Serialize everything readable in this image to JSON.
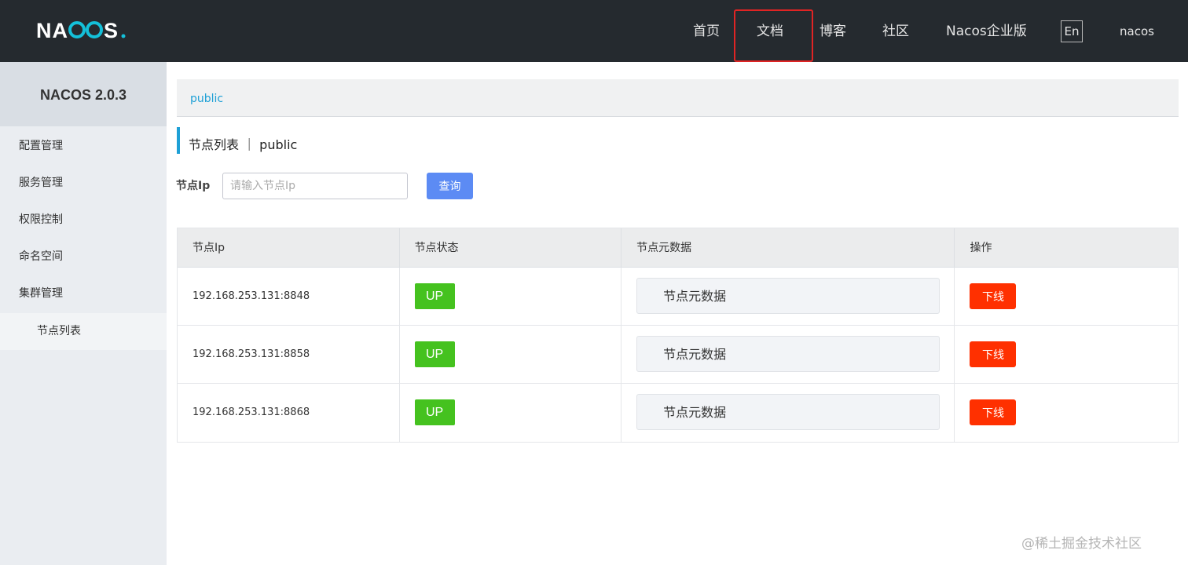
{
  "header": {
    "logo_text": "NACOS.",
    "nav": [
      "首页",
      "文档",
      "博客",
      "社区",
      "Nacos企业版"
    ],
    "lang_label": "En",
    "user": "nacos"
  },
  "sidebar": {
    "title": "NACOS 2.0.3",
    "items": [
      {
        "label": "配置管理"
      },
      {
        "label": "服务管理"
      },
      {
        "label": "权限控制"
      },
      {
        "label": "命名空间"
      },
      {
        "label": "集群管理"
      },
      {
        "label": "节点列表"
      }
    ]
  },
  "breadcrumb": {
    "namespace": "public"
  },
  "page": {
    "title": "节点列表 ｜ public"
  },
  "filter": {
    "label": "节点Ip",
    "placeholder": "请输入节点Ip",
    "value": "",
    "query_label": "查询"
  },
  "table": {
    "headers": [
      "节点Ip",
      "节点状态",
      "节点元数据",
      "操作"
    ],
    "rows": [
      {
        "ip": "192.168.253.131:8848",
        "status": "UP",
        "metadata": "节点元数据",
        "action": "下线"
      },
      {
        "ip": "192.168.253.131:8858",
        "status": "UP",
        "metadata": "节点元数据",
        "action": "下线"
      },
      {
        "ip": "192.168.253.131:8868",
        "status": "UP",
        "metadata": "节点元数据",
        "action": "下线"
      }
    ]
  },
  "colors": {
    "topbar": "#252a2f",
    "accent": "#1ea0d6",
    "status_up": "#45c21f",
    "danger": "#ff3000",
    "query": "#5c8bf4",
    "highlight": "#e02424"
  },
  "watermark": "@稀土掘金技术社区"
}
